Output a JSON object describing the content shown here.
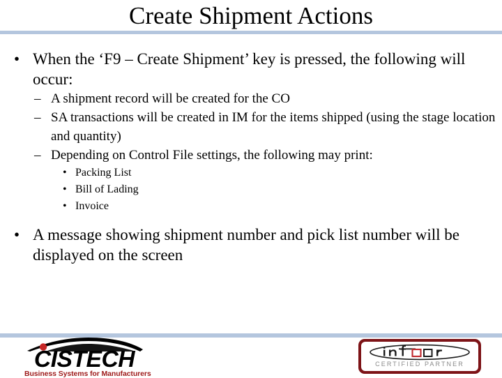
{
  "slide": {
    "title": "Create Shipment Actions",
    "accent_color": "#b4c6de",
    "background_color": "#ffffff",
    "text_color": "#000000",
    "bullets": [
      {
        "level": 1,
        "marker": "•",
        "text": "When the ‘F9 – Create Shipment’ key is pressed, the following will occur:"
      },
      {
        "level": 2,
        "marker": "–",
        "text": "A shipment record will be created for the CO"
      },
      {
        "level": 2,
        "marker": "–",
        "text": "SA transactions will be created in IM for the items shipped (using the stage location and quantity)"
      },
      {
        "level": 2,
        "marker": "–",
        "text": "Depending on Control File settings, the following may print:"
      },
      {
        "level": 3,
        "marker": "•",
        "text": "Packing List"
      },
      {
        "level": 3,
        "marker": "•",
        "text": "Bill of Lading"
      },
      {
        "level": 3,
        "marker": "•",
        "text": "Invoice"
      },
      {
        "level": 1,
        "marker": "•",
        "text": "A message showing shipment number and pick list number will be displayed on the screen"
      }
    ]
  },
  "footer": {
    "cistech_logo": {
      "wordmark": "CISTECH",
      "tagline": "Business Systems for Manufacturers",
      "tagline_color": "#9e1b1b",
      "swoosh_color": "#000000",
      "dot_color": "#c62828"
    },
    "infor_logo": {
      "wordmark": "infor",
      "subtitle": "CERTIFIED PARTNER",
      "border_color": "#7d1317",
      "subtitle_color": "#8a8a8a",
      "accent_box_color": "#c0282d"
    }
  }
}
